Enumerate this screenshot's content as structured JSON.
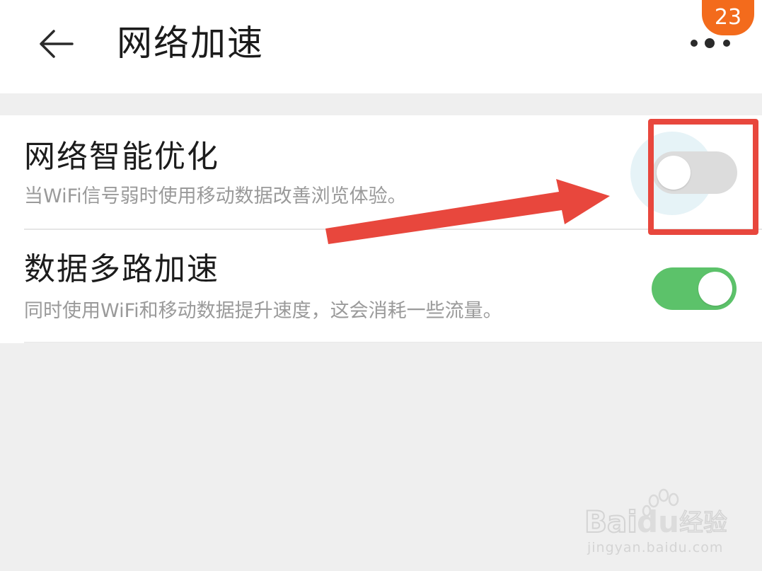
{
  "header": {
    "title": "网络加速",
    "badge_count": "23"
  },
  "settings": [
    {
      "title": "网络智能优化",
      "subtitle": "当WiFi信号弱时使用移动数据改善浏览体验。",
      "enabled": false
    },
    {
      "title": "数据多路加速",
      "subtitle": "同时使用WiFi和移动数据提升速度，这会消耗一些流量。",
      "enabled": true
    }
  ],
  "colors": {
    "accent_on": "#5cc26a",
    "toggle_off": "#dcdcdc",
    "annotation_red": "#e8473d",
    "badge": "#f36b1c"
  },
  "watermark": {
    "brand": "Bai",
    "brand_du": "du",
    "product": "经验",
    "url": "jingyan.baidu.com"
  }
}
